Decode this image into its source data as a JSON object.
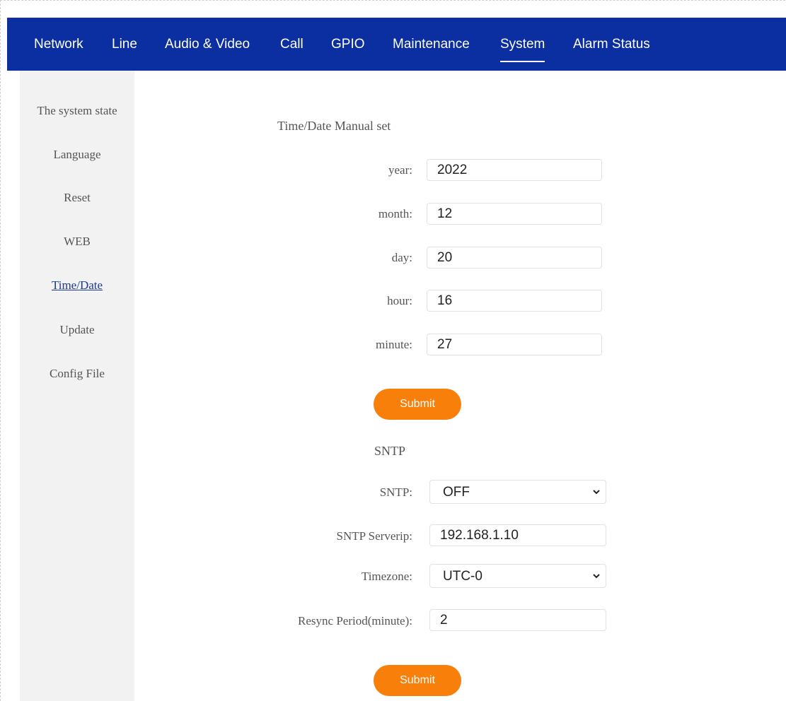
{
  "nav": {
    "items": [
      {
        "label": "Network"
      },
      {
        "label": "Line"
      },
      {
        "label": "Audio & Video"
      },
      {
        "label": "Call"
      },
      {
        "label": "GPIO"
      },
      {
        "label": "Maintenance"
      },
      {
        "label": "System",
        "active": true
      },
      {
        "label": "Alarm Status"
      }
    ]
  },
  "sidebar": {
    "items": [
      {
        "label": "The system state"
      },
      {
        "label": "Language"
      },
      {
        "label": "Reset"
      },
      {
        "label": "WEB"
      },
      {
        "label": "Time/Date",
        "active": true
      },
      {
        "label": "Update"
      },
      {
        "label": "Config File"
      }
    ]
  },
  "manual": {
    "title": "Time/Date Manual set",
    "year": {
      "label": "year:",
      "value": "2022"
    },
    "month": {
      "label": "month:",
      "value": "12"
    },
    "day": {
      "label": "day:",
      "value": "20"
    },
    "hour": {
      "label": "hour:",
      "value": "16"
    },
    "minute": {
      "label": "minute:",
      "value": "27"
    },
    "submit": "Submit"
  },
  "sntp": {
    "title": "SNTP",
    "enable": {
      "label": "SNTP:",
      "value": "OFF"
    },
    "server": {
      "label": "SNTP Serverip:",
      "value": "192.168.1.10"
    },
    "timezone": {
      "label": "Timezone:",
      "value": "UTC-0"
    },
    "resync": {
      "label": "Resync Period(minute):",
      "value": "2"
    },
    "submit": "Submit"
  },
  "colors": {
    "nav_bg": "#0b2fa0",
    "accent": "#f77f0a",
    "sidebar_bg": "#f2f2f3"
  }
}
